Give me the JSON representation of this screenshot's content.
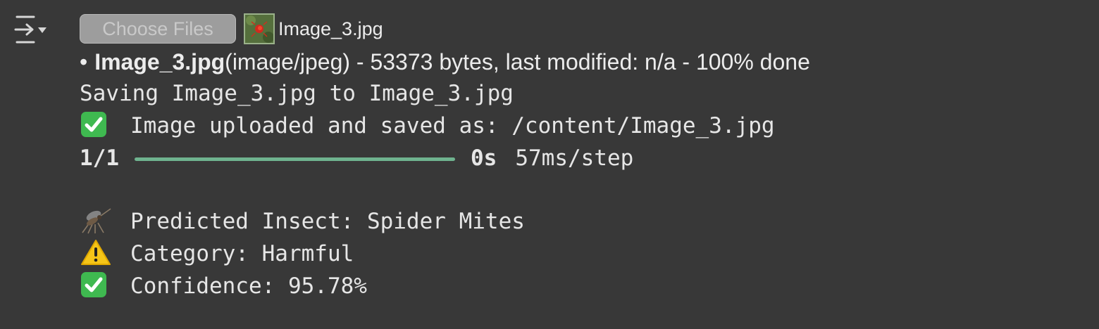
{
  "upload": {
    "choose_files_label": "Choose Files",
    "selected_file": "Image_3.jpg"
  },
  "file_info": {
    "name": "Image_3.jpg",
    "details": "(image/jpeg) - 53373 bytes, last modified: n/a - 100% done"
  },
  "log": {
    "saving": "Saving Image_3.jpg to Image_3.jpg",
    "uploaded": "Image uploaded and saved as: /content/Image_3.jpg"
  },
  "progress": {
    "step": "1/1",
    "fraction_done": 1.0,
    "time": "0s",
    "rate": "57ms/step"
  },
  "results": {
    "insect": "Predicted Insect: Spider Mites",
    "category": "Category: Harmful",
    "confidence": "Confidence: 95.78%"
  },
  "icons": {
    "cell_toggle": "output-collapse-icon",
    "check": "check-mark-emoji",
    "warning": "warning-emoji",
    "insect": "mosquito-emoji"
  },
  "colors": {
    "background": "#383838",
    "progress_bar": "#6fb38f",
    "check_green": "#3fb950",
    "warning_yellow": "#f5c518"
  }
}
